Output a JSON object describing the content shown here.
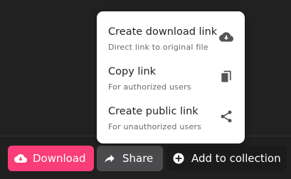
{
  "share_menu": {
    "items": [
      {
        "title": "Create download link",
        "subtitle": "Direct link to original file",
        "icon": "cloud-download-icon"
      },
      {
        "title": "Copy link",
        "subtitle": "For authorized users",
        "icon": "copy-icon"
      },
      {
        "title": "Create public link",
        "subtitle": "For unauthorized users",
        "icon": "share-icon"
      }
    ]
  },
  "toolbar": {
    "download_label": "Download",
    "share_label": "Share",
    "add_to_collection_label": "Add to collection",
    "download_icon": "cloud-download-icon",
    "share_icon": "share-arrow-icon",
    "add_icon": "plus-circle-icon"
  },
  "colors": {
    "accent": "#f93d78",
    "background": "#212121",
    "share_button": "#4b4b4d",
    "menu_background": "#ffffff"
  }
}
